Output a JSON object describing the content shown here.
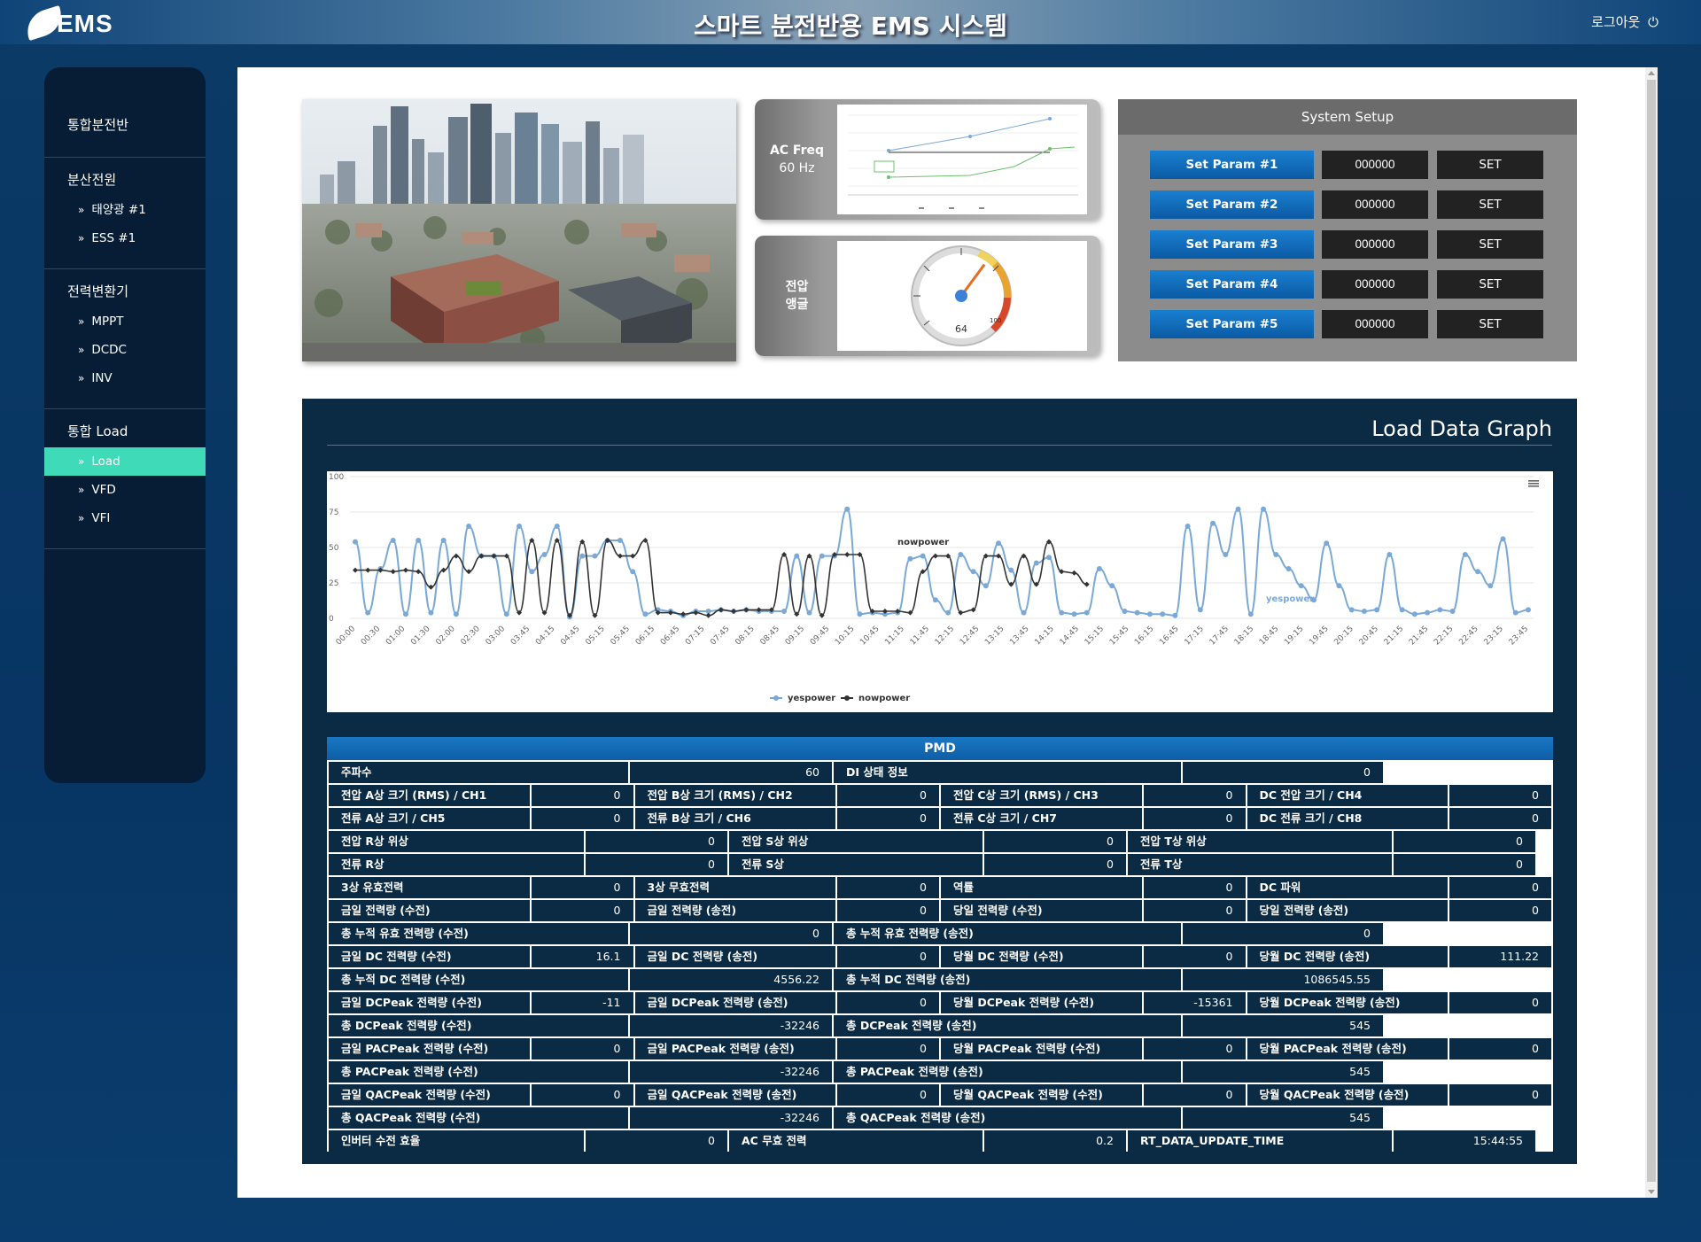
{
  "header": {
    "logo_text": "EMS",
    "title": "스마트 분전반용 EMS 시스템",
    "logout_label": "로그아웃",
    "logout_icon": "power-icon"
  },
  "sidebar": {
    "groups": [
      {
        "title": "통합분전반",
        "items": []
      },
      {
        "title": "분산전원",
        "items": [
          "태양광 #1",
          "ESS #1"
        ]
      },
      {
        "title": "전력변환기",
        "items": [
          "MPPT",
          "DCDC",
          "INV"
        ]
      },
      {
        "title": "통합 Load",
        "items": [
          "Load",
          "VFD",
          "VFI"
        ]
      }
    ],
    "active_item": "Load",
    "active_color": "#3fdbb9"
  },
  "cards": {
    "freq": {
      "label": "AC Freq",
      "value": "60 Hz"
    },
    "volt": {
      "label_line1": "전압",
      "label_line2": "앵글",
      "gauge_value": 64,
      "gauge_max_label": "100"
    }
  },
  "system_setup": {
    "title": "System Setup",
    "params": [
      {
        "label": "Set Param #1",
        "value": "000000",
        "button": "SET"
      },
      {
        "label": "Set Param #2",
        "value": "000000",
        "button": "SET"
      },
      {
        "label": "Set Param #3",
        "value": "000000",
        "button": "SET"
      },
      {
        "label": "Set Param #4",
        "value": "000000",
        "button": "SET"
      },
      {
        "label": "Set Param #5",
        "value": "000000",
        "button": "SET"
      }
    ]
  },
  "load_panel": {
    "title": "Load Data Graph"
  },
  "chart_data": {
    "type": "line",
    "ylim": [
      0,
      100
    ],
    "yticks": [
      0,
      25,
      50,
      75,
      100
    ],
    "x_tick_labels": [
      "00:00",
      "00:30",
      "01:00",
      "01:30",
      "02:00",
      "02:30",
      "03:00",
      "03:45",
      "04:15",
      "04:45",
      "05:15",
      "05:45",
      "06:15",
      "06:45",
      "07:15",
      "07:45",
      "08:15",
      "08:45",
      "09:15",
      "09:45",
      "10:15",
      "10:45",
      "11:15",
      "11:45",
      "12:15",
      "12:45",
      "13:15",
      "13:45",
      "14:15",
      "14:45",
      "15:15",
      "15:45",
      "16:15",
      "16:45",
      "17:15",
      "17:45",
      "18:15",
      "18:45",
      "19:15",
      "19:45",
      "20:15",
      "20:45",
      "21:15",
      "21:45",
      "22:15",
      "22:45",
      "23:15",
      "23:45"
    ],
    "series": [
      {
        "name": "yespower",
        "color": "#7aa9d8",
        "values": [
          54,
          4,
          35,
          55,
          3,
          55,
          4,
          55,
          3,
          65,
          44,
          44,
          3,
          65,
          33,
          45,
          65,
          1,
          44,
          44,
          55,
          55,
          33,
          3,
          6,
          5,
          2,
          5,
          5,
          6,
          5,
          6,
          5,
          5,
          5,
          44,
          4,
          44,
          44,
          77,
          3,
          4,
          3,
          4,
          42,
          44,
          13,
          4,
          45,
          33,
          23,
          53,
          34,
          4,
          39,
          43,
          4,
          3,
          4,
          35,
          23,
          5,
          4,
          3,
          3,
          2,
          65,
          6,
          67,
          45,
          77,
          3,
          77,
          45,
          35,
          23,
          13,
          53,
          23,
          6,
          5,
          6,
          45,
          6,
          3,
          4,
          6,
          5,
          45,
          33,
          23,
          56,
          4,
          6
        ]
      },
      {
        "name": "nowpower",
        "color": "#333333",
        "values": [
          34,
          34,
          34,
          33,
          34,
          33,
          22,
          34,
          44,
          33,
          44,
          44,
          44,
          4,
          55,
          4,
          55,
          2,
          54,
          2,
          55,
          44,
          44,
          55,
          4,
          4,
          3,
          4,
          2,
          6,
          5,
          6,
          6,
          6,
          45,
          3,
          44,
          2,
          45,
          45,
          45,
          5,
          5,
          5,
          4,
          33,
          44,
          44,
          4,
          6,
          44,
          44,
          24,
          44,
          24,
          54,
          33,
          32,
          24
        ]
      }
    ],
    "annotations": [
      "nowpower",
      "yespower"
    ],
    "legend": [
      "yespower",
      "nowpower"
    ],
    "legend_position": "bottom-center"
  },
  "pmd": {
    "title": "PMD",
    "rows": [
      {
        "layout": "2",
        "cells": [
          "주파수",
          "60",
          "DI 상태 정보",
          "0"
        ]
      },
      {
        "layout": "4",
        "cells": [
          "전압 A상 크기 (RMS) / CH1",
          "0",
          "전압 B상 크기 (RMS) / CH2",
          "0",
          "전압 C상 크기 (RMS) / CH3",
          "0",
          "DC 전압 크기 / CH4",
          "0"
        ]
      },
      {
        "layout": "4",
        "cells": [
          "전류 A상 크기 / CH5",
          "0",
          "전류 B상 크기 / CH6",
          "0",
          "전류 C상 크기 / CH7",
          "0",
          "DC 전류 크기 / CH8",
          "0"
        ]
      },
      {
        "layout": "3",
        "cells": [
          "전압 R상 위상",
          "0",
          "전압 S상 위상",
          "0",
          "전압 T상 위상",
          "0"
        ]
      },
      {
        "layout": "3",
        "cells": [
          "전류 R상",
          "0",
          "전류 S상",
          "0",
          "전류 T상",
          "0"
        ]
      },
      {
        "layout": "4",
        "cells": [
          "3상 유효전력",
          "0",
          "3상 무효전력",
          "0",
          "역률",
          "0",
          "DC 파워",
          "0"
        ]
      },
      {
        "layout": "4",
        "cells": [
          "금일 전력량 (수전)",
          "0",
          "금일 전력량 (송전)",
          "0",
          "당일 전력량 (수전)",
          "0",
          "당일 전력량 (송전)",
          "0"
        ]
      },
      {
        "layout": "2",
        "cells": [
          "총 누적 유효 전력량 (수전)",
          "0",
          "총 누적 유효 전력량 (송전)",
          "0"
        ]
      },
      {
        "layout": "4",
        "cells": [
          "금일 DC 전력량 (수전)",
          "16.1",
          "금일 DC 전력량 (송전)",
          "0",
          "당월 DC 전력량 (수전)",
          "0",
          "당월 DC 전력량 (송전)",
          "111.22"
        ]
      },
      {
        "layout": "2",
        "cells": [
          "총 누적 DC 전력량 (수전)",
          "4556.22",
          "총 누적 DC 전력량 (송전)",
          "1086545.55"
        ]
      },
      {
        "layout": "4",
        "cells": [
          "금일 DCPeak 전력량 (수전)",
          "-11",
          "금일 DCPeak 전력량 (송전)",
          "0",
          "당월 DCPeak 전력량 (수전)",
          "-15361",
          "당월 DCPeak 전력량 (송전)",
          "0"
        ]
      },
      {
        "layout": "2",
        "cells": [
          "총 DCPeak 전력량 (수전)",
          "-32246",
          "총 DCPeak 전력량 (송전)",
          "545"
        ]
      },
      {
        "layout": "4",
        "cells": [
          "금일 PACPeak 전력량 (수전)",
          "0",
          "금일 PACPeak 전력량 (송전)",
          "0",
          "당월 PACPeak 전력량 (수전)",
          "0",
          "당월 PACPeak 전력량 (송전)",
          "0"
        ]
      },
      {
        "layout": "2",
        "cells": [
          "총 PACPeak 전력량 (수전)",
          "-32246",
          "총 PACPeak 전력량 (송전)",
          "545"
        ]
      },
      {
        "layout": "4",
        "cells": [
          "금일 QACPeak 전력량 (수전)",
          "0",
          "금일 QACPeak 전력량 (송전)",
          "0",
          "당월 QACPeak 전력량 (수전)",
          "0",
          "당월 QACPeak 전력량 (송전)",
          "0"
        ]
      },
      {
        "layout": "2",
        "cells": [
          "총 QACPeak 전력량 (수전)",
          "-32246",
          "총 QACPeak 전력량 (송전)",
          "545"
        ]
      },
      {
        "layout": "3",
        "cells": [
          "인버터 수전 효율",
          "0",
          "AC 무효 전력",
          "0.2",
          "RT_DATA_UPDATE_TIME",
          "15:44:55"
        ]
      }
    ]
  }
}
